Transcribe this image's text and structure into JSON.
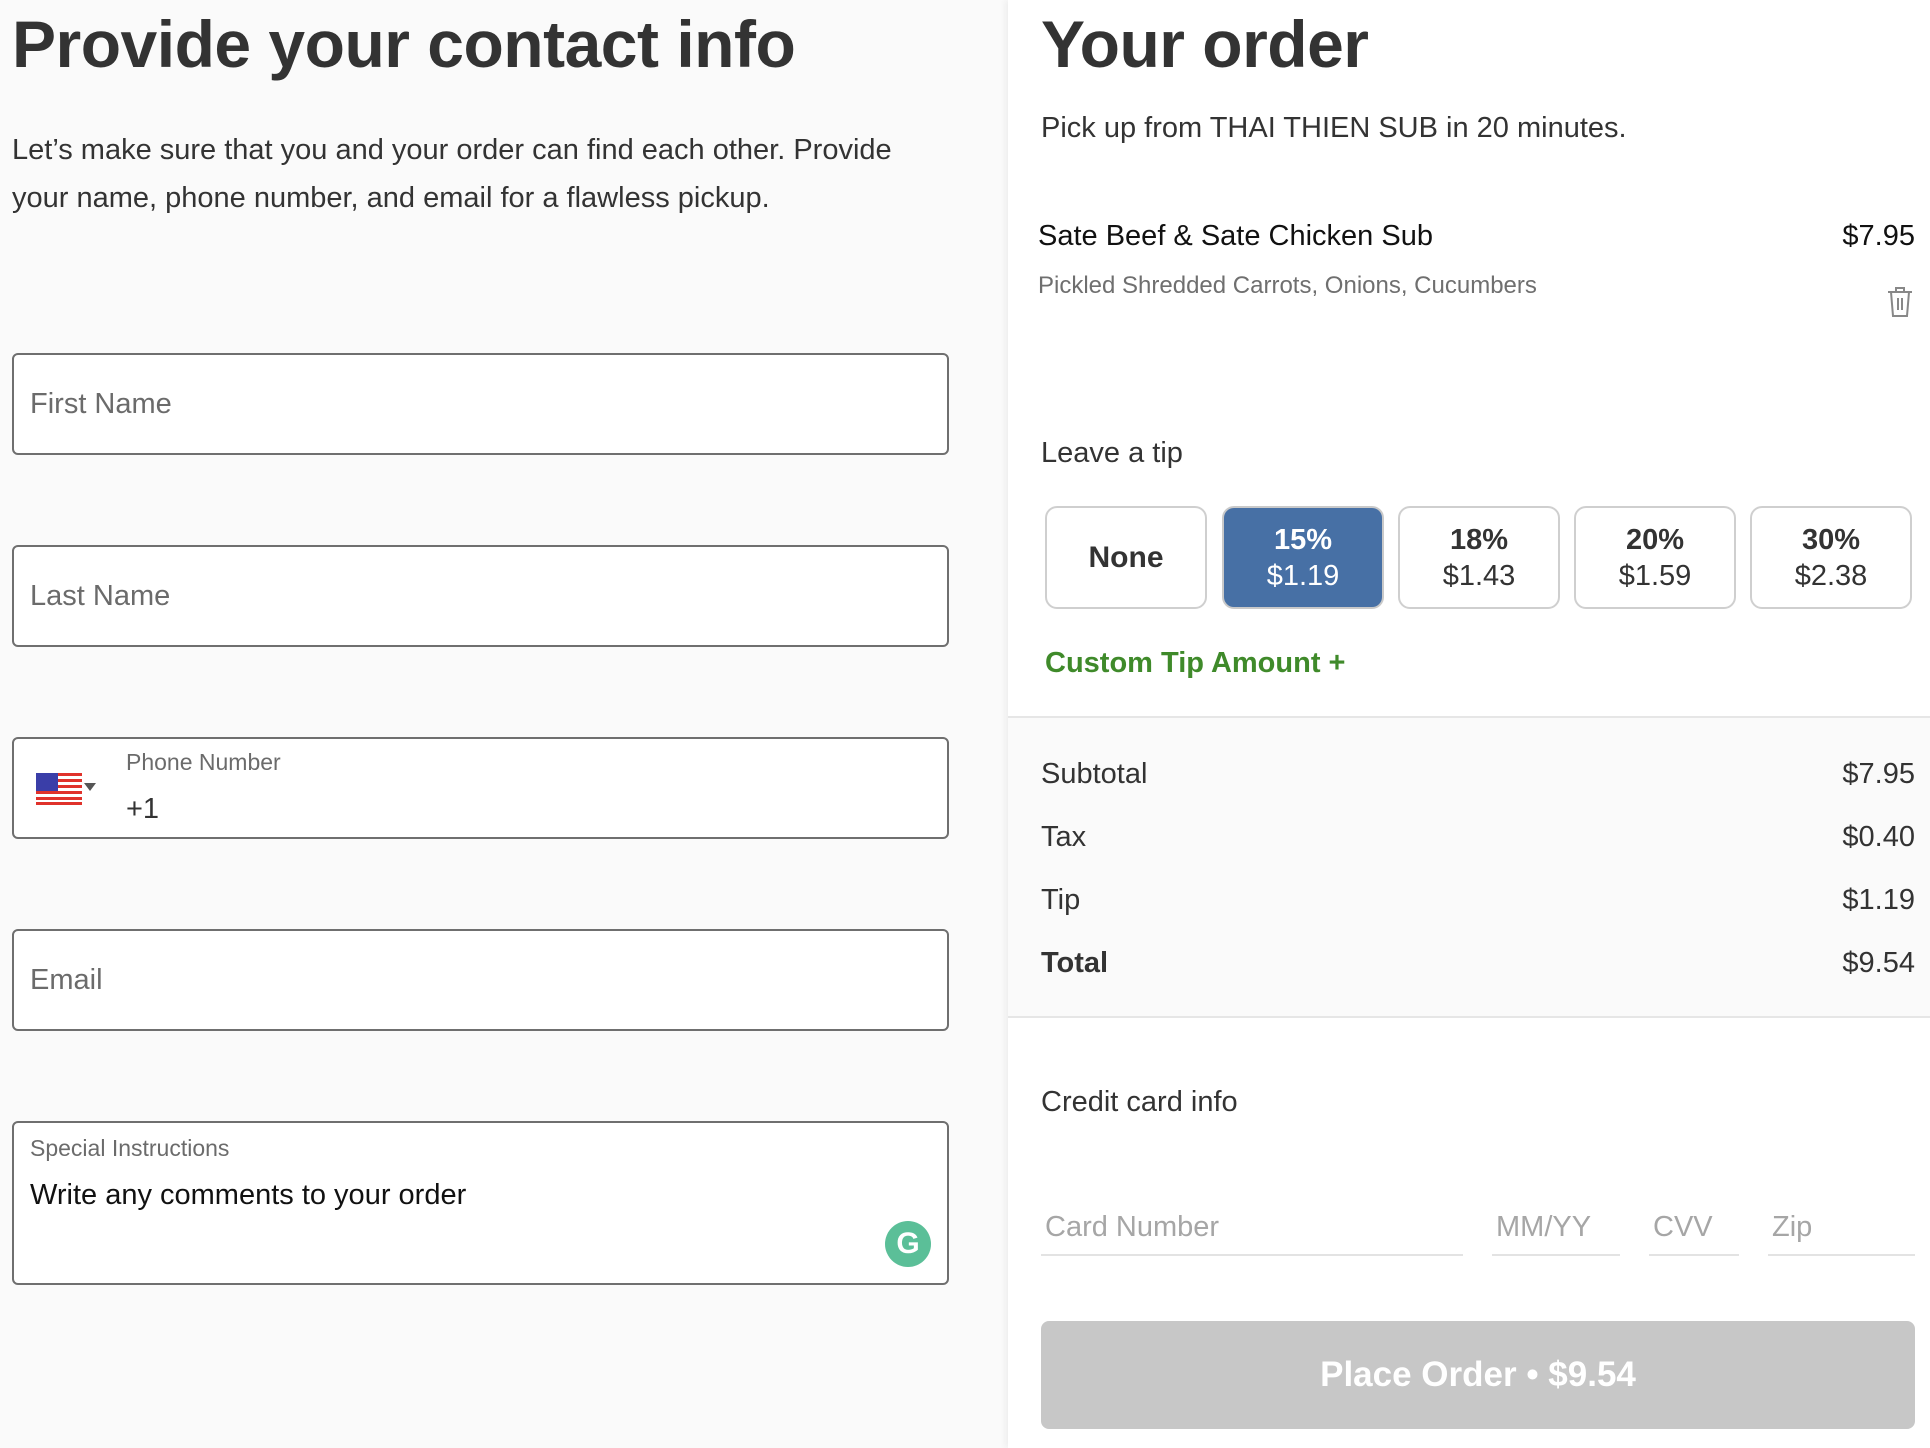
{
  "contact": {
    "title": "Provide your contact info",
    "intro": "Let’s make sure that you and your order can find each other. Provide your name, phone number, and email for a flawless pickup.",
    "first_name": {
      "placeholder": "First Name",
      "value": ""
    },
    "last_name": {
      "placeholder": "Last Name",
      "value": ""
    },
    "phone": {
      "label": "Phone Number",
      "value": "+1",
      "country_icon": "us-flag-icon"
    },
    "email": {
      "placeholder": "Email",
      "value": ""
    },
    "special_instructions": {
      "label": "Special Instructions",
      "placeholder": "Write any comments to your order"
    },
    "grammarly_glyph": "G"
  },
  "order": {
    "title": "Your order",
    "pickup": "Pick up from THAI THIEN SUB in 20 minutes.",
    "items": [
      {
        "name": "Sate Beef & Sate Chicken Sub",
        "price": "$7.95",
        "modifiers": "Pickled Shredded Carrots, Onions, Cucumbers"
      }
    ],
    "tip": {
      "label": "Leave a tip",
      "options": [
        {
          "pct": "None",
          "amount": "",
          "selected": false
        },
        {
          "pct": "15%",
          "amount": "$1.19",
          "selected": true
        },
        {
          "pct": "18%",
          "amount": "$1.43",
          "selected": false
        },
        {
          "pct": "20%",
          "amount": "$1.59",
          "selected": false
        },
        {
          "pct": "30%",
          "amount": "$2.38",
          "selected": false
        }
      ],
      "custom_label": "Custom Tip Amount +"
    },
    "summary": [
      {
        "label": "Subtotal",
        "value": "$7.95"
      },
      {
        "label": "Tax",
        "value": "$0.40"
      },
      {
        "label": "Tip",
        "value": "$1.19"
      },
      {
        "label": "Total",
        "value": "$9.54"
      }
    ],
    "credit_card": {
      "label": "Credit card info",
      "card_number_placeholder": "Card Number",
      "expiry_placeholder": "MM/YY",
      "cvv_placeholder": "CVV",
      "zip_placeholder": "Zip"
    },
    "place_order_label": "Place Order • $9.54"
  },
  "colors": {
    "accent_selected": "#4770a5",
    "custom_tip_green": "#3f8a2a",
    "button_disabled": "#c7c7c7"
  }
}
